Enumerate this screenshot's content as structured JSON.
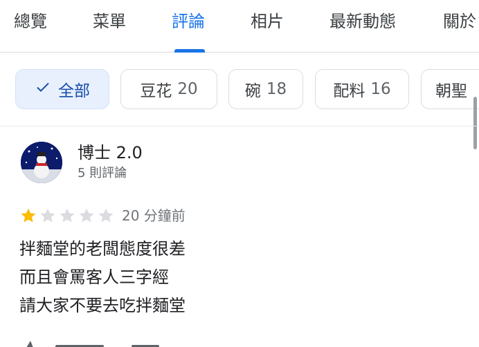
{
  "tabs": [
    {
      "label": "總覽",
      "active": false
    },
    {
      "label": "菜單",
      "active": false
    },
    {
      "label": "評論",
      "active": true
    },
    {
      "label": "相片",
      "active": false
    },
    {
      "label": "最新動態",
      "active": false
    },
    {
      "label": "關於",
      "active": false
    }
  ],
  "filters": [
    {
      "label": "全部",
      "count": "",
      "selected": true,
      "icon": "check-icon"
    },
    {
      "label": "豆花",
      "count": "20",
      "selected": false
    },
    {
      "label": "碗",
      "count": "18",
      "selected": false
    },
    {
      "label": "配料",
      "count": "16",
      "selected": false
    },
    {
      "label": "朝聖",
      "count": "",
      "selected": false
    }
  ],
  "review": {
    "author": "博士 2.0",
    "author_meta": "5 則評論",
    "rating": 1,
    "rating_max": 5,
    "time": "20 分鐘前",
    "text_lines": [
      "拌麵堂的老闆態度很差",
      "而且會罵客人三字經",
      "請大家不要去吃拌麵堂"
    ]
  },
  "colors": {
    "accent": "#1a73e8",
    "star_filled": "#fbbc04",
    "star_empty": "#dadce0",
    "chip_selected_bg": "#e8f0fe"
  }
}
